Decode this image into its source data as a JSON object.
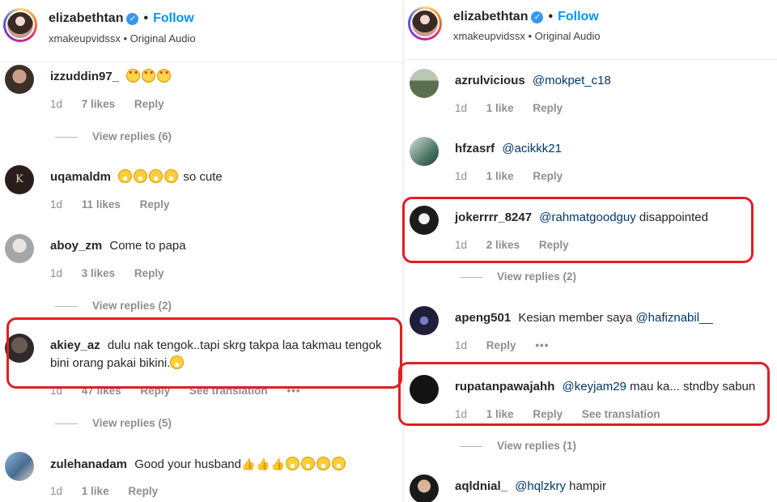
{
  "left": {
    "header": {
      "username": "elizabethtan",
      "follow_label": "Follow",
      "subtitle": "xmakeupvidssx • Original Audio"
    },
    "comments": [
      {
        "username": "izzuddin97_",
        "text": "",
        "emoji": [
          "love",
          "love",
          "love"
        ],
        "age": "1d",
        "likes": "7 likes",
        "reply": "Reply",
        "view_replies": "View replies (6)"
      },
      {
        "username": "uqamaldm",
        "text": "so cute",
        "emoji": [
          "laugh",
          "laugh",
          "laugh",
          "laugh"
        ],
        "age": "1d",
        "likes": "11 likes",
        "reply": "Reply"
      },
      {
        "username": "aboy_zm",
        "text": "Come to papa",
        "age": "1d",
        "likes": "3 likes",
        "reply": "Reply",
        "view_replies": "View replies (2)"
      },
      {
        "username": "akiey_az",
        "text_line1": "dulu nak tengok..tapi skrg takpa laa takmau tengok",
        "text_line2": "bini orang pakai bikini.",
        "age": "1d",
        "likes": "47 likes",
        "reply": "Reply",
        "see_translation": "See translation",
        "view_replies": "View replies (5)"
      },
      {
        "username": "zulehanadam",
        "text": "Good your husband",
        "age": "1d",
        "likes": "1 like",
        "reply": "Reply"
      }
    ]
  },
  "right": {
    "header": {
      "username": "elizabethtan",
      "follow_label": "Follow",
      "subtitle": "xmakeupvidssx • Original Audio"
    },
    "comments": [
      {
        "username": "azrulvicious",
        "mention": "@mokpet_c18",
        "text": "",
        "age": "1d",
        "likes": "1 like",
        "reply": "Reply"
      },
      {
        "username": "hfzasrf",
        "mention": "@acikkk21",
        "text": "",
        "age": "1d",
        "likes": "1 like",
        "reply": "Reply"
      },
      {
        "username": "jokerrrr_8247",
        "mention": "@rahmatgoodguy",
        "text": "disappointed",
        "age": "1d",
        "likes": "2 likes",
        "reply": "Reply",
        "view_replies": "View replies (2)"
      },
      {
        "username": "apeng501",
        "text": "Kesian member saya",
        "mention": "@hafiznabil__",
        "age": "1d",
        "reply": "Reply"
      },
      {
        "username": "rupatanpawajahh",
        "mention": "@keyjam29",
        "text": "mau ka... stndby sabun",
        "age": "1d",
        "likes": "1 like",
        "reply": "Reply",
        "see_translation": "See translation",
        "view_replies": "View replies (1)"
      },
      {
        "username": "aqldnial_",
        "mention": "@hqlzkry",
        "text": "hampir"
      }
    ]
  },
  "colors": {
    "follow": "#0095f6",
    "highlight": "#e01e24",
    "meta": "#8e8e8e",
    "mention": "#00376b"
  }
}
